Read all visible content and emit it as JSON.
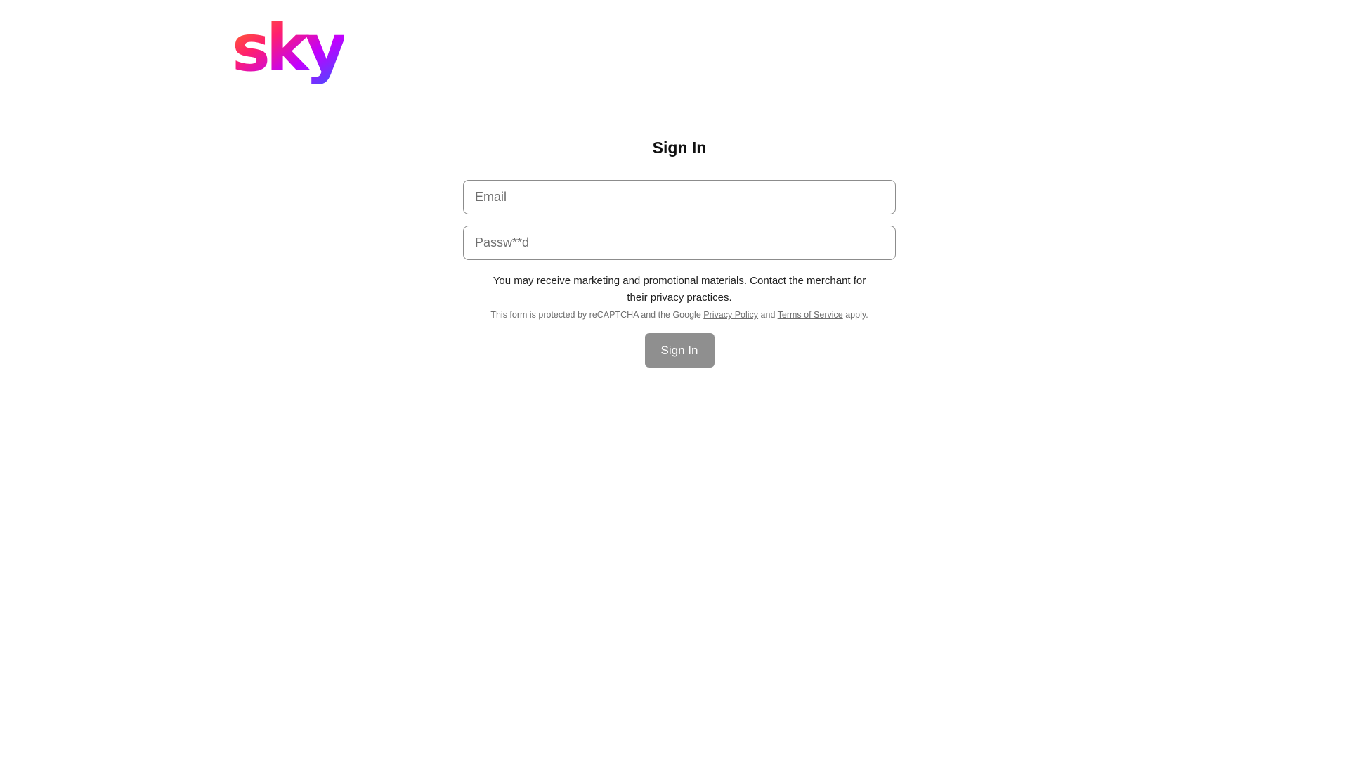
{
  "brand": {
    "logo_text": "sky",
    "gradient_colors": [
      "#ff8a00",
      "#ff1f6e",
      "#c100ff",
      "#2f5bff"
    ]
  },
  "form": {
    "title": "Sign In",
    "email_placeholder": "Email",
    "password_placeholder": "Passw**d",
    "notice": "You may receive marketing and promotional materials. Contact the merchant for their privacy practices.",
    "legal_prefix": "This form is protected by reCAPTCHA and the Google",
    "privacy_link": "Privacy Policy",
    "legal_and": "and",
    "terms_link": "Terms of Service",
    "legal_suffix": "apply.",
    "submit_label": "Sign In"
  },
  "colors": {
    "button_disabled": "#8f8f8f",
    "field_border": "#8c8c8c"
  }
}
